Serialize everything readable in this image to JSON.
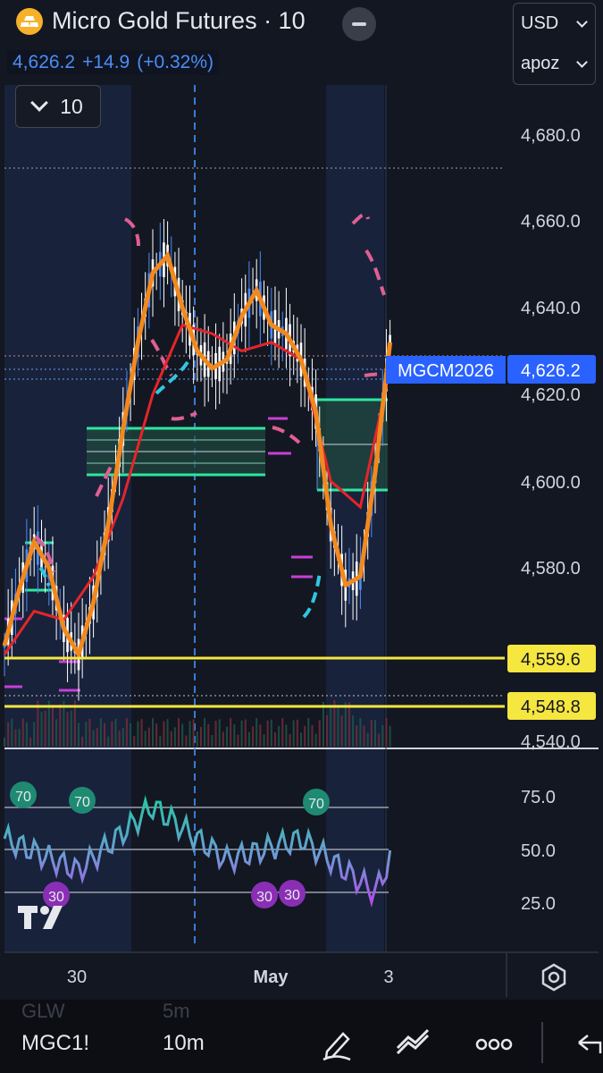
{
  "header": {
    "title": "Micro Gold Futures · 10",
    "logo": "gold-bars-icon",
    "price": "4,626.2",
    "change": "+14.9",
    "change_pct": "(+0.32%)",
    "interval_value": "10"
  },
  "currency": {
    "currency": "USD",
    "scale": "apoz"
  },
  "price_axis": {
    "labels": [
      "4,680.0",
      "4,660.0",
      "4,640.0",
      "4,620.0",
      "4,600.0",
      "4,580.0",
      "4,540.0"
    ],
    "symbol_tag": "MGCM2026",
    "last_price_tag": "4,626.2",
    "level_tags": [
      "4,559.6",
      "4,548.8"
    ]
  },
  "rsi_axis": {
    "labels": [
      "75.0",
      "50.0",
      "25.0"
    ],
    "markers": [
      "70",
      "70",
      "70",
      "30",
      "30",
      "30"
    ]
  },
  "time_axis": {
    "labels": [
      "30",
      "May",
      "3"
    ]
  },
  "bottom_bar": {
    "ghost_symbol": "GLW",
    "ghost_tf": "5m",
    "symbol": "MGC1!",
    "timeframe": "10m"
  },
  "chart_data": {
    "type": "line",
    "series": [
      {
        "x": [
          0,
          4,
          8,
          12,
          16,
          20,
          24,
          28,
          32,
          36,
          40,
          44,
          48,
          52,
          56,
          60,
          64,
          68,
          72,
          76,
          80,
          84,
          88,
          92,
          96,
          100,
          104
        ],
        "values": [
          4562,
          4575,
          4586,
          4580,
          4566,
          4560,
          4572,
          4590,
          4612,
          4632,
          4648,
          4652,
          4640,
          4630,
          4626,
          4628,
          4638,
          4644,
          4636,
          4634,
          4628,
          4616,
          4590,
          4576,
          4578,
          4602,
          4632
        ]
      },
      {
        "x": [
          0,
          8,
          16,
          24,
          32,
          40,
          48,
          56,
          64,
          72,
          80,
          88,
          96,
          104
        ],
        "values": [
          4560,
          4570,
          4568,
          4578,
          4596,
          4620,
          4636,
          4634,
          4630,
          4632,
          4628,
          4600,
          4594,
          4626
        ]
      },
      {
        "x": [
          0,
          20,
          40,
          60,
          80,
          100,
          104
        ],
        "values": [
          55,
          40,
          70,
          45,
          55,
          30,
          45
        ]
      }
    ],
    "ylim": [
      4535,
      4692
    ],
    "horizontal_levels": [
      4559.6,
      4548.8
    ]
  }
}
